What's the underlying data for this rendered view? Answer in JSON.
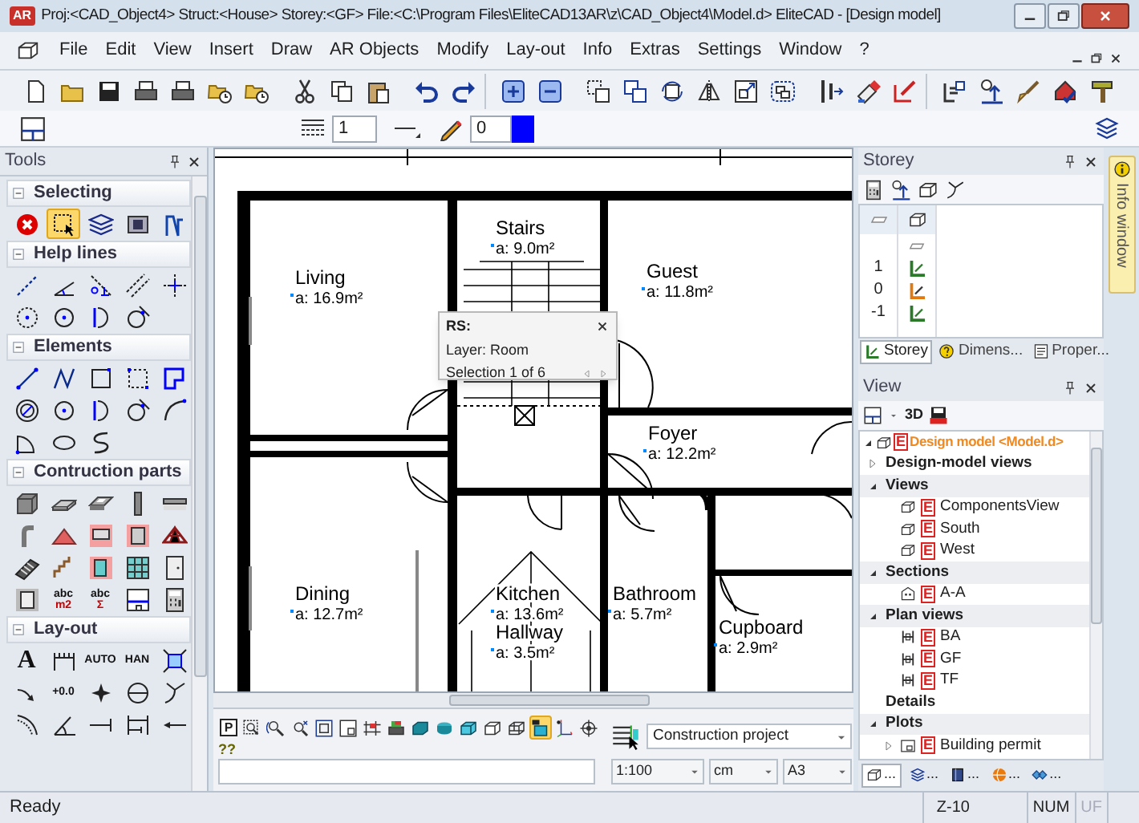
{
  "window": {
    "app_icon": "AR",
    "title": "Proj:<CAD_Object4> Struct:<House>  Storey:<GF>  File:<C:\\Program Files\\EliteCAD13AR\\z\\CAD_Object4\\Model.d>  EliteCAD - [Design model]"
  },
  "menu": [
    "File",
    "Edit",
    "View",
    "Insert",
    "Draw",
    "AR Objects",
    "Modify",
    "Lay-out",
    "Info",
    "Extras",
    "Settings",
    "Window",
    "?"
  ],
  "attribute_bar": {
    "line_type": "1",
    "pen": "0",
    "color": "#0000ff"
  },
  "tools_panel": {
    "title": "Tools",
    "sections": [
      {
        "label": "Selecting",
        "expanded": true,
        "tools": [
          {
            "selected": false
          },
          {
            "selected": true
          },
          {
            "selected": false
          },
          {
            "selected": false
          },
          {
            "selected": false
          }
        ]
      },
      {
        "label": "Help lines",
        "expanded": true,
        "tools": [
          {
            "selected": false
          },
          {
            "selected": false
          },
          {
            "selected": false
          },
          {
            "selected": false
          },
          {
            "selected": false
          },
          {
            "selected": false
          },
          {
            "selected": false
          },
          {
            "selected": false
          },
          {
            "selected": false
          }
        ]
      },
      {
        "label": "Elements",
        "expanded": true,
        "tools": [
          {
            "selected": false
          },
          {
            "selected": false
          },
          {
            "selected": false
          },
          {
            "selected": false
          },
          {
            "selected": false
          },
          {
            "selected": false
          },
          {
            "selected": false
          },
          {
            "selected": false
          },
          {
            "selected": false
          },
          {
            "selected": false
          },
          {
            "selected": false
          },
          {
            "selected": false
          },
          {
            "selected": false
          }
        ]
      },
      {
        "label": "Contruction parts",
        "expanded": true,
        "tools": [
          {
            "selected": false
          },
          {
            "selected": false
          },
          {
            "selected": false
          },
          {
            "selected": false
          },
          {
            "selected": false
          },
          {
            "selected": false
          },
          {
            "selected": false
          },
          {
            "selected": false
          },
          {
            "selected": false
          },
          {
            "selected": false
          },
          {
            "selected": false
          },
          {
            "selected": false
          },
          {
            "selected": false
          },
          {
            "selected": false
          },
          {
            "selected": false
          },
          {
            "selected": false
          },
          {
            "selected": false,
            "text": "abc",
            "subtext": "m2"
          },
          {
            "selected": false,
            "text": "abc",
            "subtext": "Σ"
          },
          {
            "selected": false
          },
          {
            "selected": false
          }
        ]
      },
      {
        "label": "Lay-out",
        "expanded": true,
        "tools": [
          {
            "selected": false,
            "text": "A"
          },
          {
            "selected": false
          },
          {
            "selected": false,
            "text": "AUTO"
          },
          {
            "selected": false,
            "text": "HAN"
          },
          {
            "selected": false
          },
          {
            "selected": false
          },
          {
            "selected": false,
            "text": "+0.0"
          },
          {
            "selected": false
          },
          {
            "selected": false
          },
          {
            "selected": false
          },
          {
            "selected": false
          },
          {
            "selected": false
          },
          {
            "selected": false
          },
          {
            "selected": false
          },
          {
            "selected": false
          }
        ]
      }
    ]
  },
  "drawing": {
    "rooms": [
      {
        "name": "Living",
        "area": "a: 16.9m²"
      },
      {
        "name": "Stairs",
        "area": "a: 9.0m²"
      },
      {
        "name": "Guest",
        "area": "a: 11.8m²"
      },
      {
        "name": "Foyer",
        "area": "a: 12.2m²"
      },
      {
        "name": "Dining",
        "area": "a: 12.7m²"
      },
      {
        "name": "Kitchen",
        "area": "a: 13.6m²"
      },
      {
        "name": "Hallway",
        "area": "a: 3.5m²"
      },
      {
        "name": "Bathroom",
        "area": "a: 5.7m²"
      },
      {
        "name": "Cupboard",
        "area": "a: 2.9m²"
      }
    ],
    "popup": {
      "title": "RS:",
      "layer": "Layer: Room",
      "selection": "Selection 1 of 6"
    }
  },
  "view_toolbar": [
    {
      "selected": false,
      "text": "P"
    },
    {
      "selected": false
    },
    {
      "selected": false
    },
    {
      "selected": false
    },
    {
      "selected": false
    },
    {
      "selected": false
    },
    {
      "selected": false
    },
    {
      "selected": false
    },
    {
      "selected": false
    },
    {
      "selected": false
    },
    {
      "selected": false
    },
    {
      "selected": false
    },
    {
      "selected": false
    },
    {
      "selected": true
    },
    {
      "selected": false
    },
    {
      "selected": false
    }
  ],
  "command_line": {
    "prompt": "??"
  },
  "project_selector": {
    "value": "Construction project"
  },
  "scale_selectors": [
    "1:100",
    "cm",
    "A3"
  ],
  "storey_panel": {
    "title": "Storey",
    "storeys": [
      {
        "number": "1",
        "selected": false
      },
      {
        "number": "0",
        "selected": true
      },
      {
        "number": "-1",
        "selected": false
      }
    ],
    "tabs": [
      {
        "label": "Storey",
        "selected": true
      },
      {
        "label": "Dimens...",
        "selected": false
      },
      {
        "label": "Proper...",
        "selected": false
      }
    ]
  },
  "info_tab": {
    "label": "Info window"
  },
  "view_panel": {
    "title": "View",
    "toolbar_label": "3D",
    "tree": [
      {
        "kind": "root",
        "label": "Design model <Model.d>",
        "badge": "E",
        "expanded": true,
        "children": [
          {
            "kind": "group",
            "label": "Design-model views",
            "expanded": false
          },
          {
            "kind": "group",
            "label": "Views",
            "expanded": true,
            "children": [
              {
                "kind": "item",
                "label": "ComponentsView",
                "badge": "E"
              },
              {
                "kind": "item",
                "label": "South",
                "badge": "E"
              },
              {
                "kind": "item",
                "label": "West",
                "badge": "E"
              }
            ]
          },
          {
            "kind": "group",
            "label": "Sections",
            "expanded": true,
            "children": [
              {
                "kind": "item",
                "label": "A-A",
                "badge": "E"
              }
            ]
          },
          {
            "kind": "group",
            "label": "Plan views",
            "expanded": true,
            "children": [
              {
                "kind": "item",
                "label": "BA",
                "badge": "E"
              },
              {
                "kind": "item",
                "label": "GF",
                "badge": "E"
              },
              {
                "kind": "item",
                "label": "TF",
                "badge": "E"
              }
            ]
          },
          {
            "kind": "group",
            "label": "Details"
          },
          {
            "kind": "group",
            "label": "Plots",
            "expanded": true,
            "children": [
              {
                "kind": "item",
                "label": "Building permit",
                "badge": "E",
                "expanded": false
              }
            ]
          }
        ]
      }
    ],
    "tabs": [
      {
        "label": "...",
        "selected": true
      },
      {
        "label": "...",
        "selected": false
      },
      {
        "label": "...",
        "selected": false
      },
      {
        "label": "...",
        "selected": false
      },
      {
        "label": "...",
        "selected": false
      }
    ]
  },
  "status_bar": {
    "message": "Ready",
    "zoom": "Z-10",
    "indicators": [
      {
        "text": "NUM",
        "active": true
      },
      {
        "text": "UF",
        "active": false
      }
    ]
  }
}
